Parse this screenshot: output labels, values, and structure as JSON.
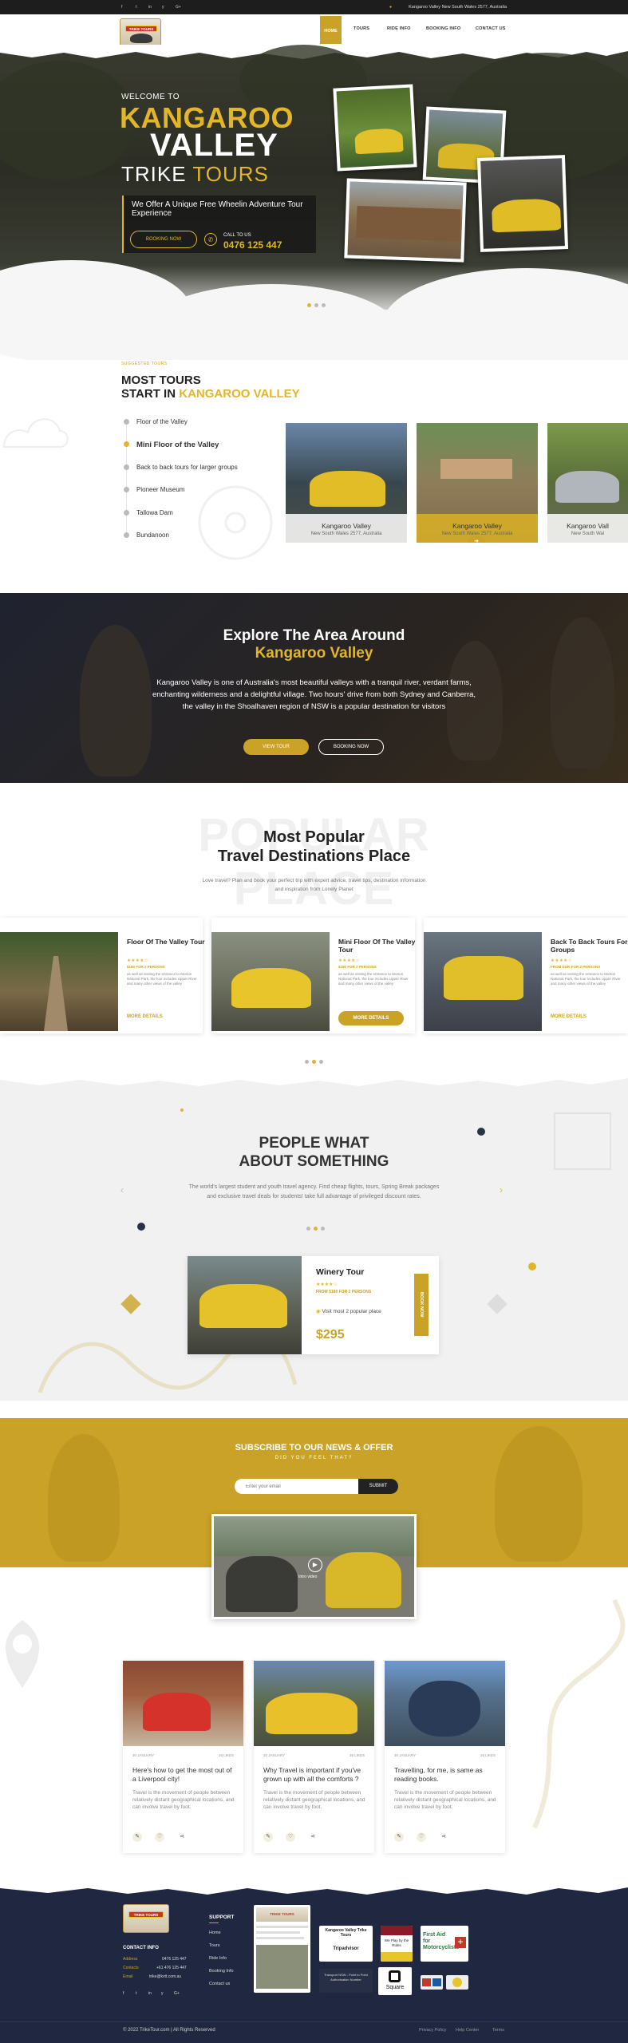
{
  "topbar": {
    "social": [
      "f",
      "t",
      "in",
      "y",
      "G+"
    ],
    "location": "Kangaroo Valley New South Wales 2577, Australia"
  },
  "header": {
    "logo_text": "TRIKE TOURS",
    "nav": [
      "HOME",
      "TOURS",
      "RIDE INFO",
      "BOOKING INFO",
      "CONTACT US"
    ]
  },
  "hero": {
    "welcome": "WELCOME TO",
    "line1": "KANGAROO",
    "line2": "VALLEY",
    "line3a": "TRIKE",
    "line3b": "TOURS",
    "tagline": "We Offer A Unique Free Wheelin Adventure Tour Experience",
    "book_button": "BOOKING NOW",
    "call_label": "CALL TO US",
    "phone": "0476 125 447"
  },
  "tours": {
    "subtitle": "SUGGESTED TOURS",
    "heading1": "MOST TOURS",
    "heading2a": "START IN",
    "heading2b": "KANGAROO VALLEY",
    "items": [
      "Floor of the Valley",
      "Mini Floor of the Valley",
      "Back to back tours for larger groups",
      "Pioneer Museum",
      "Tallowa Dam",
      "Bundanoon"
    ],
    "cards": [
      {
        "title": "Kangaroo Valley",
        "sub": "New South Wales 2577, Australia"
      },
      {
        "title": "Kangaroo Valley",
        "sub": "New South Wales 2577, Australia"
      },
      {
        "title": "Kangaroo Vall",
        "sub": "New South Wal"
      }
    ]
  },
  "explore": {
    "heading1": "Explore The Area Around",
    "heading2": "Kangaroo Valley",
    "text": "Kangaroo Valley is one of Australia's most beautiful valleys with a tranquil river, verdant farms, enchanting wilderness and a delightful village. Two hours' drive from both Sydney and Canberra, the valley in the Shoalhaven region of NSW is a popular destination for visitors",
    "view_button": "VIEW TOUR",
    "book_button": "BOOKING NOW"
  },
  "popular": {
    "watermark": "POPULAR PLACE",
    "heading1": "Most Popular",
    "heading2": "Travel Destinations Place",
    "text": "Love travel? Plan and book your perfect trip with expert advice, travel tips, destination information and inspiration from Lonely Planet",
    "cards": [
      {
        "title": "Floor Of The Valley Tour",
        "stars": "★★★★☆",
        "price": "$180 FOR 2 PERSONS",
        "desc": "as well as visiting the entrance to Morton National Park, the tour includes Upper River and many other views of the valley",
        "more": "MORE DETAILS"
      },
      {
        "title": "Mini Floor Of The Valley Tour",
        "stars": "★★★★☆",
        "price": "$180 FOR 2 PERSONS",
        "desc": "as well as visiting the entrance to Morton National Park, the tour includes Upper River and many other views of the valley",
        "more": "MORE DETAILS"
      },
      {
        "title": "Back To Back Tours For Groups",
        "stars": "★★★★☆",
        "price": "FROM $180 FOR 2 PERSONS",
        "desc": "as well as visiting the entrance to Morton National Park, the tour includes Upper River and many other views of the valley",
        "more": "MORE DETAILS"
      }
    ]
  },
  "testimonial": {
    "heading1": "PEOPLE WHAT",
    "heading2": "ABOUT SOMETHING",
    "text": "The world's largest student and youth travel agency. Find cheap flights, tours, Spring Break packages and exclusive travel deals for students! take full advantage of privileged discount rates.",
    "card": {
      "title": "Winery Tour",
      "stars": "★★★★☆",
      "price_note": "FROM $180 FOR 2 PERSONS",
      "visit": "Visit most 2 popular place",
      "price": "$295",
      "book": "BOOK NOW"
    }
  },
  "subscribe": {
    "heading": "SUBSCRIBE TO OUR NEWS & OFFER",
    "sub": "DID YOU FEEL THAT?",
    "placeholder": "Enter your email",
    "button": "SUBMIT",
    "video_label": "Intro video"
  },
  "blog": [
    {
      "date": "30 JANUARY",
      "comments": "26 LIKES",
      "title": "Here's how to get the most out of a Liverpool city!",
      "excerpt": "Travel is the movement of people between relatively distant geographical locations, and can involve travel by foot."
    },
    {
      "date": "30 JANUARY",
      "comments": "26 LIKES",
      "title": "Why Travel is important if you've grown up with all the comforts ?",
      "excerpt": "Travel is the movement of people between relatively distant geographical locations, and can involve travel by foot."
    },
    {
      "date": "30 JANUARY",
      "comments": "26 LIKES",
      "title": "Travelling, for me, is same as reading books.",
      "excerpt": "Travel is the movement of people between relatively distant geographical locations, and can involve travel by foot."
    }
  ],
  "footer": {
    "contact_title": "CONTACT INFO",
    "address_label": "Address",
    "address": "0476 125 447",
    "contacts_label": "Contacts",
    "contacts": "+61 476 125 447",
    "email_label": "Email",
    "email": "trike@kvtt.com.au",
    "support_title": "SUPPORT",
    "links": [
      "Home",
      "Tours",
      "Ride Info",
      "Booking Info",
      "Contact us"
    ],
    "badges": [
      "Kangaroo Valley Trike Tours",
      "Tripadvisor",
      "We Play by the Rules",
      "First Aid for Motorcyclists",
      "Square",
      "Transport NSW - Point to Point Authorisation Number"
    ],
    "copyright": "© 2022 TrikeTour.com  |  All Rights Reserved",
    "bottom_links": [
      "Privacy Policy",
      "Help Center",
      "Terms"
    ]
  }
}
